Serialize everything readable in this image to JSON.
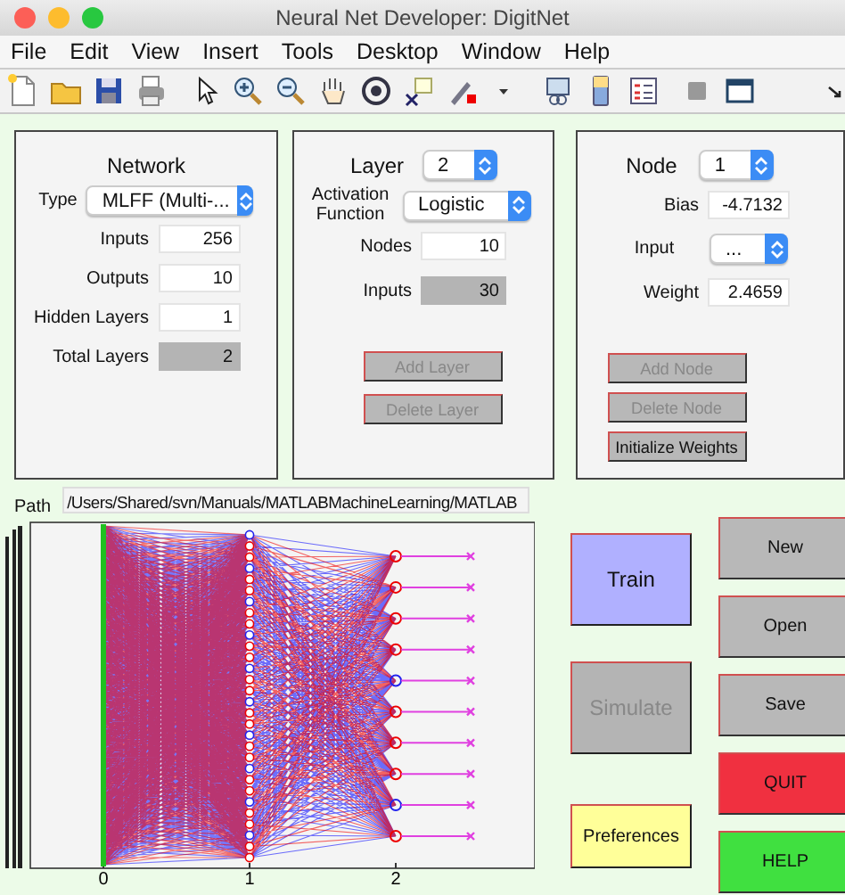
{
  "window": {
    "title": "Neural Net Developer: DigitNet"
  },
  "menu": [
    "File",
    "Edit",
    "View",
    "Insert",
    "Tools",
    "Desktop",
    "Window",
    "Help"
  ],
  "network_panel": {
    "title": "Network",
    "type": {
      "label": "Type",
      "value": "MLFF (Multi-..."
    },
    "fields": [
      {
        "label": "Inputs",
        "value": "256",
        "disabled": false
      },
      {
        "label": "Outputs",
        "value": "10",
        "disabled": false
      },
      {
        "label": "Hidden Layers",
        "value": "1",
        "disabled": false
      },
      {
        "label": "Total Layers",
        "value": "2",
        "disabled": true
      }
    ]
  },
  "layer_panel": {
    "title": "Layer",
    "layer": "2",
    "activation": {
      "label": "Activation Function",
      "value": "Logistic"
    },
    "fields": [
      {
        "label": "Nodes",
        "value": "10",
        "disabled": false
      },
      {
        "label": "Inputs",
        "value": "30",
        "disabled": true
      }
    ],
    "buttons": [
      {
        "label": "Add Layer",
        "disabled": true
      },
      {
        "label": "Delete Layer",
        "disabled": true
      }
    ]
  },
  "node_panel": {
    "title": "Node",
    "node": "1",
    "fields": [
      {
        "kind": "field",
        "label": "Bias",
        "value": "-4.7132"
      },
      {
        "kind": "select",
        "label": "Input",
        "value": "..."
      },
      {
        "kind": "field",
        "label": "Weight",
        "value": "2.4659"
      }
    ],
    "buttons": [
      {
        "label": "Add Node",
        "disabled": true
      },
      {
        "label": "Delete Node",
        "disabled": true
      },
      {
        "label": "Initialize Weights",
        "disabled": false
      }
    ]
  },
  "path": {
    "label": "Path",
    "value": "/Users/Shared/svn/Manuals/MATLABMachineLearning/MATLAB"
  },
  "plot": {
    "x_ticks": [
      "0",
      "1",
      "2"
    ]
  },
  "actions": [
    {
      "label": "Train",
      "color": "#b0b0ff",
      "disabled": false
    },
    {
      "label": "Simulate",
      "color": "#b4b4b4",
      "disabled": true
    },
    {
      "label": "Preferences",
      "color": "#ffff99",
      "disabled": false
    }
  ],
  "file_buttons": [
    {
      "label": "New",
      "color": "#b8b8b8"
    },
    {
      "label": "Open",
      "color": "#b8b8b8"
    },
    {
      "label": "Save",
      "color": "#b8b8b8"
    },
    {
      "label": "QUIT",
      "color": "#f03040"
    },
    {
      "label": "HELP",
      "color": "#40e040"
    }
  ]
}
